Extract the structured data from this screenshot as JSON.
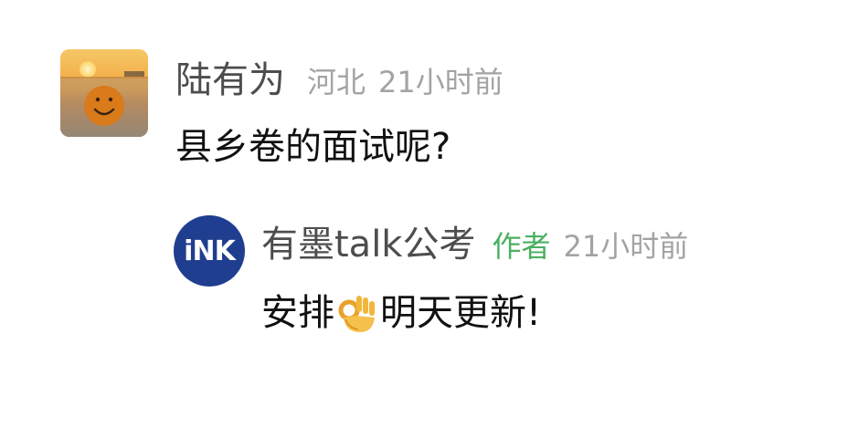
{
  "comment": {
    "user": {
      "name": "陆有为",
      "location": "河北",
      "time": "21小时前",
      "avatar_icon": "sunset-smiley-avatar"
    },
    "text": "县乡卷的面试呢?"
  },
  "reply": {
    "user": {
      "name": "有墨talk公考",
      "badge": "作者",
      "time": "21小时前",
      "avatar_icon": "ink-logo-avatar",
      "avatar_text": "iNK"
    },
    "text_before_emoji": "安排",
    "emoji_icon": "ok-hand-emoji",
    "text_after_emoji": "明天更新!"
  },
  "colors": {
    "name": "#4d4d4d",
    "meta": "#a3a3a3",
    "author_badge": "#4ab061",
    "body_text": "#111111",
    "ink_avatar_bg": "#1f3e8f"
  }
}
